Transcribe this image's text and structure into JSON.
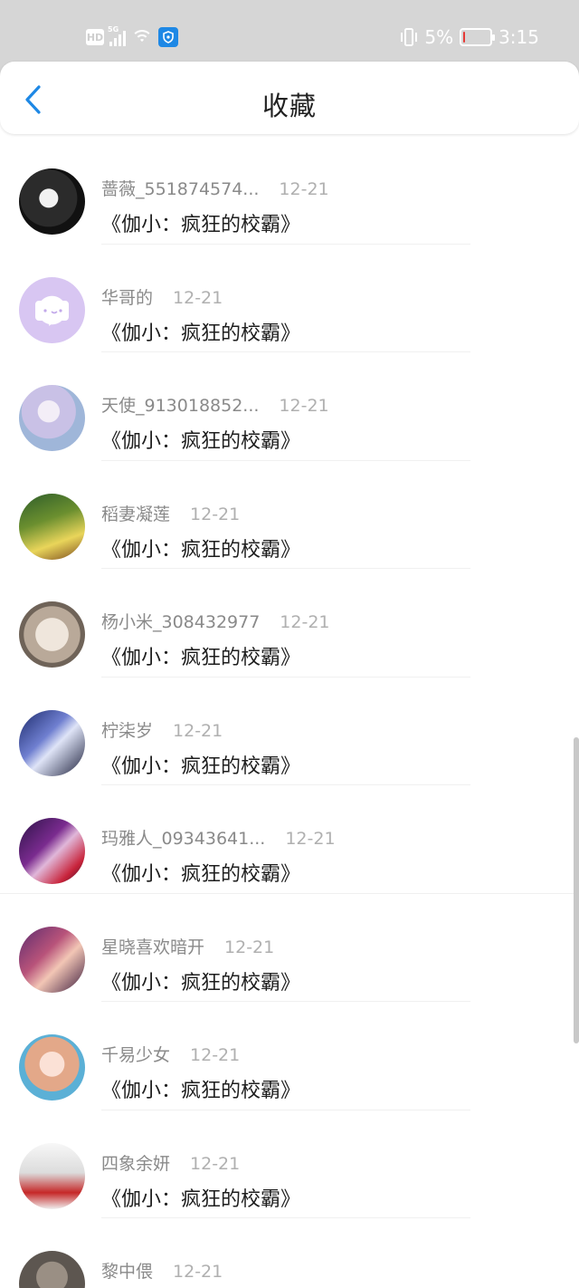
{
  "status_bar": {
    "hd_label": "HD",
    "network_label": "5G",
    "battery_text": "5%",
    "battery_level": 0.05,
    "time": "3:15",
    "icons": [
      "signal-icon",
      "wifi-icon",
      "shield-icon",
      "vibrate-icon",
      "battery-icon"
    ]
  },
  "header": {
    "back_icon": "chevron-left-icon",
    "title": "收藏"
  },
  "items": [
    {
      "name": "蔷薇_551874574...",
      "date": "12-21",
      "book": "《伽小：疯狂的校霸》"
    },
    {
      "name": "华哥的",
      "date": "12-21",
      "book": "《伽小：疯狂的校霸》"
    },
    {
      "name": "天使_913018852...",
      "date": "12-21",
      "book": "《伽小：疯狂的校霸》"
    },
    {
      "name": "稻妻凝莲",
      "date": "12-21",
      "book": "《伽小：疯狂的校霸》"
    },
    {
      "name": "杨小米_308432977",
      "date": "12-21",
      "book": "《伽小：疯狂的校霸》"
    },
    {
      "name": "柠柒岁",
      "date": "12-21",
      "book": "《伽小：疯狂的校霸》"
    },
    {
      "name": "玛雅人_09343641...",
      "date": "12-21",
      "book": "《伽小：疯狂的校霸》"
    },
    {
      "name": "星晓喜欢暗开",
      "date": "12-21",
      "book": "《伽小：疯狂的校霸》"
    },
    {
      "name": "千易少女",
      "date": "12-21",
      "book": "《伽小：疯狂的校霸》"
    },
    {
      "name": "四象余妍",
      "date": "12-21",
      "book": "《伽小：疯狂的校霸》"
    },
    {
      "name": "黎中偎",
      "date": "12-21",
      "book": ""
    }
  ],
  "colors": {
    "accent": "#1e88e5",
    "status_bar_bg": "#d6d6d6",
    "name_text": "#8a8a8a",
    "date_text": "#b0b0b0",
    "book_text": "#1e1e1e"
  }
}
